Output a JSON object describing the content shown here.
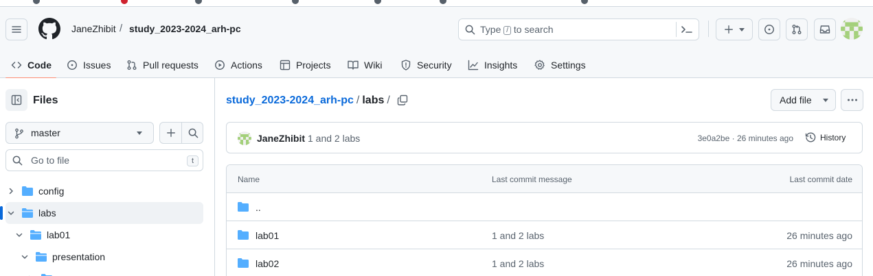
{
  "header": {
    "owner": "JaneZhibit",
    "separator": "/",
    "repo": "study_2023-2024_arh-pc",
    "search": {
      "prefix": "Type",
      "key": "/",
      "suffix": "to search"
    }
  },
  "tabs": [
    {
      "label": "Code",
      "icon": "code-icon",
      "active": true
    },
    {
      "label": "Issues",
      "icon": "issue-opened-icon"
    },
    {
      "label": "Pull requests",
      "icon": "git-pull-request-icon"
    },
    {
      "label": "Actions",
      "icon": "play-icon"
    },
    {
      "label": "Projects",
      "icon": "table-icon"
    },
    {
      "label": "Wiki",
      "icon": "book-icon"
    },
    {
      "label": "Security",
      "icon": "shield-icon"
    },
    {
      "label": "Insights",
      "icon": "graph-icon"
    },
    {
      "label": "Settings",
      "icon": "gear-icon"
    }
  ],
  "sidebar": {
    "title": "Files",
    "branch": "master",
    "goto_placeholder": "Go to file",
    "goto_key": "t",
    "tree": [
      {
        "name": "config",
        "expanded": false,
        "depth": 0
      },
      {
        "name": "labs",
        "expanded": true,
        "depth": 0,
        "selected": true
      },
      {
        "name": "lab01",
        "expanded": true,
        "depth": 1
      },
      {
        "name": "presentation",
        "expanded": true,
        "depth": 2
      }
    ]
  },
  "main": {
    "path_repo": "study_2023-2024_arh-pc",
    "path_folder": "labs",
    "path_sep": "/",
    "add_file_label": "Add file",
    "commit": {
      "author": "JaneZhibit",
      "message": "1 and 2 labs",
      "meta": "3e0a2be · 26 minutes ago",
      "history_label": "History"
    },
    "table": {
      "headers": {
        "name": "Name",
        "message": "Last commit message",
        "date": "Last commit date"
      },
      "rows": [
        {
          "name": "..",
          "message": "",
          "date": ""
        },
        {
          "name": "lab01",
          "message": "1 and 2 labs",
          "date": "26 minutes ago"
        },
        {
          "name": "lab02",
          "message": "1 and 2 labs",
          "date": "26 minutes ago"
        }
      ]
    }
  },
  "colors": {
    "accent_link": "#0969da",
    "folder": "#54aeff",
    "tab_underline": "#fd8c73",
    "border": "#d1d9e0"
  }
}
